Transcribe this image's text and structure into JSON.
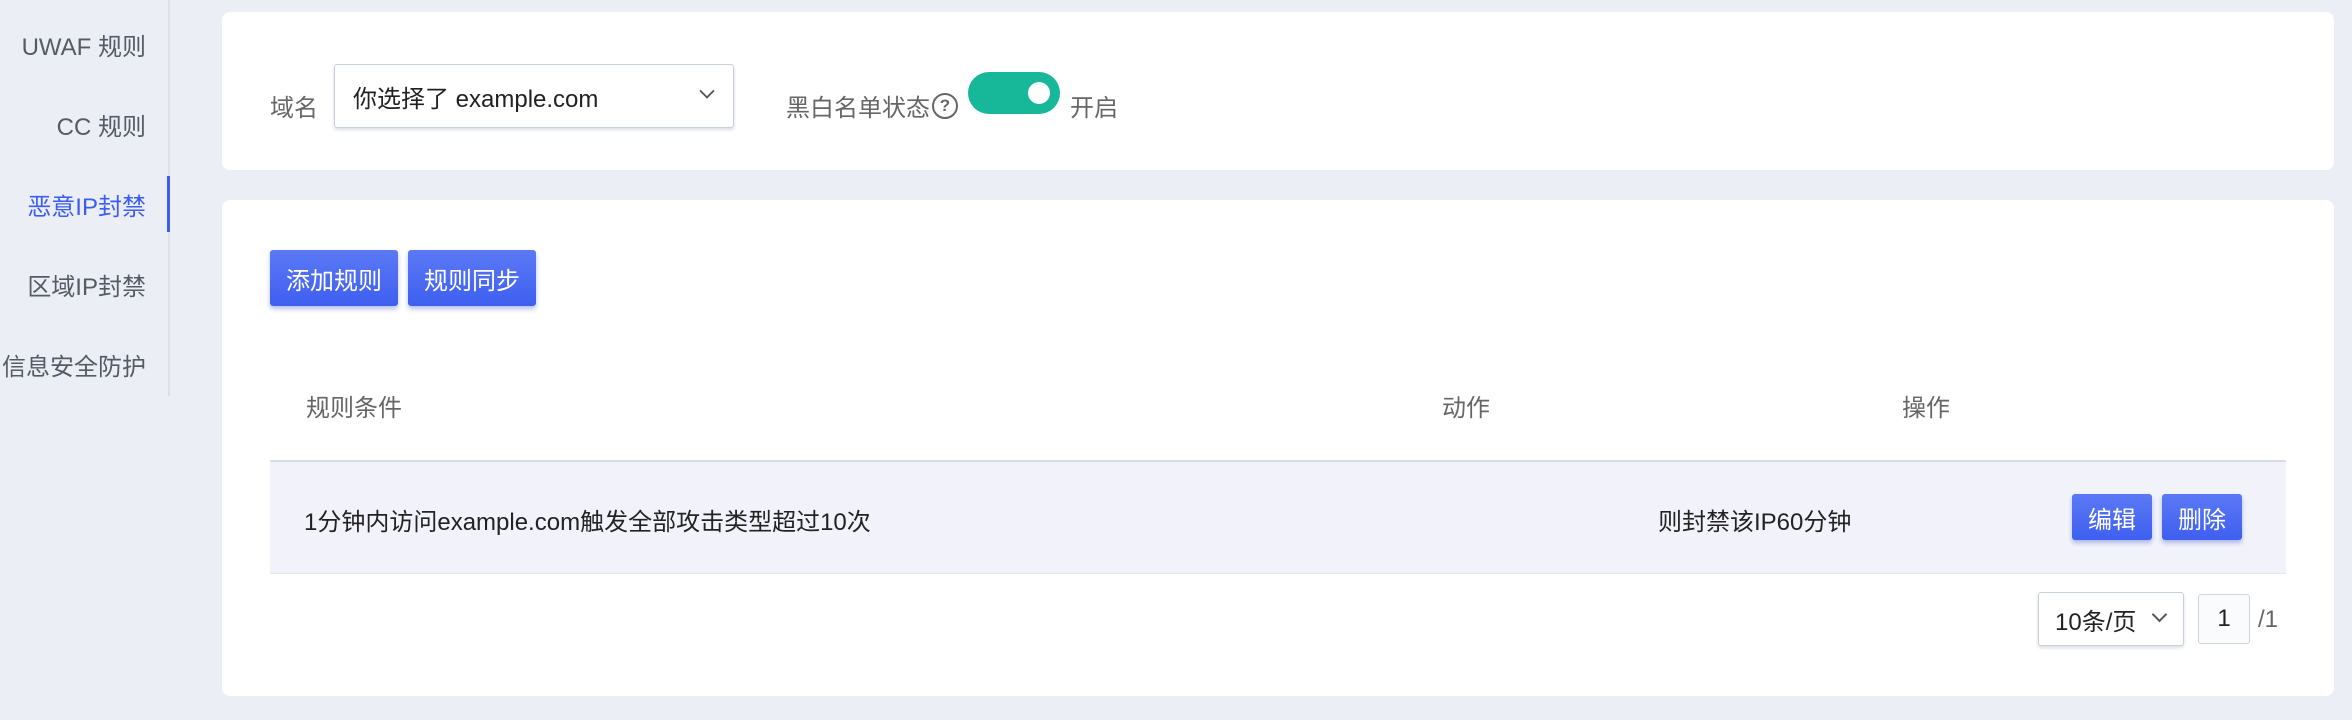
{
  "sidebar": {
    "items": [
      {
        "label": "UWAF 规则",
        "active": false
      },
      {
        "label": "CC 规则",
        "active": false
      },
      {
        "label": "恶意IP封禁",
        "active": true
      },
      {
        "label": "区域IP封禁",
        "active": false
      },
      {
        "label": "信息安全防护",
        "active": false
      }
    ]
  },
  "filter": {
    "domain_label": "域名",
    "domain_value": "你选择了 example.com",
    "blacklist_label": "黑白名单状态",
    "help_icon": "?",
    "toggle_on": true,
    "toggle_text": "开启"
  },
  "toolbar": {
    "add_label": "添加规则",
    "sync_label": "规则同步"
  },
  "table": {
    "headers": [
      "规则条件",
      "动作",
      "操作"
    ],
    "rows": [
      {
        "condition": "1分钟内访问example.com触发全部攻击类型超过10次",
        "action": "则封禁该IP60分钟",
        "edit_label": "编辑",
        "delete_label": "删除"
      }
    ]
  },
  "pagination": {
    "page_size": "10条/页",
    "current_page": "1",
    "total": "/1"
  },
  "colors": {
    "accent": "#3e5ff0",
    "toggle": "#17b89a",
    "background": "#eceef6"
  }
}
